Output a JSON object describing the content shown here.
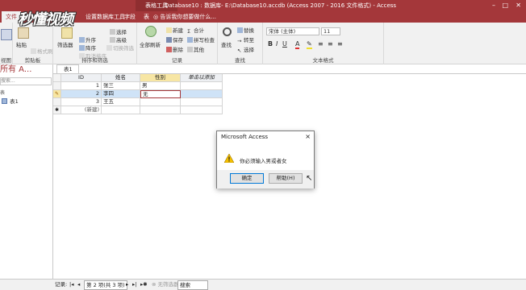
{
  "titlebar": {
    "context_tab": "表格工具",
    "title": "Database10 : 数据库- E:\\Database10.accdb (Access 2007 - 2016 文件格式) - Access"
  },
  "tabs": {
    "file": "文件",
    "table_tools_partial": "设置数据库工具",
    "field": "字段",
    "table": "表",
    "tell_me": "告诉我你想要做什么..."
  },
  "ribbon": {
    "views_label": "视图",
    "clipboard": {
      "label": "剪贴板",
      "paste": "粘贴",
      "format_painter": "格式刷"
    },
    "sort_filter": {
      "label": "排序和筛选",
      "filter": "筛选器",
      "ascending": "升序",
      "descending": "降序",
      "remove_sort": "取消排序",
      "selection": "选择",
      "advanced": "高级",
      "toggle_filter": "切换筛选"
    },
    "records": {
      "label": "记录",
      "refresh_all": "全部刷新",
      "new": "新建",
      "save": "保存",
      "delete": "删除",
      "totals": "合计",
      "spelling": "拼写检查",
      "more": "其他"
    },
    "find": {
      "label": "查找",
      "find": "查找",
      "replace": "替换",
      "goto": "转至",
      "select": "选择"
    },
    "text_format": {
      "label": "文本格式",
      "font": "宋体 (主体)",
      "size": "11"
    }
  },
  "navpane": {
    "header": "所有 A...",
    "search_placeholder": "搜索...",
    "section": "表",
    "table_item": "表1"
  },
  "document": {
    "tab": "表1",
    "headers": [
      "ID",
      "姓名",
      "性别",
      "单击以添加"
    ],
    "rows": [
      {
        "id": "1",
        "name": "张三",
        "gender": "男"
      },
      {
        "id": "2",
        "name": "李四",
        "gender": "无"
      },
      {
        "id": "3",
        "name": "王五",
        "gender": ""
      }
    ],
    "new_row": "(新建)"
  },
  "dialog": {
    "title": "Microsoft Access",
    "close": "×",
    "message": "你必须输入男或者女",
    "ok": "确定",
    "help": "帮助(H)"
  },
  "statusbar": {
    "records_label": "记录:",
    "position": "第 2 项(共 3 项)",
    "no_filter": "无筛选器",
    "search": "搜索"
  },
  "watermark": "秒懂视频",
  "colors": {
    "accent": "#a4373a",
    "selected_row": "#cfe3f7"
  }
}
